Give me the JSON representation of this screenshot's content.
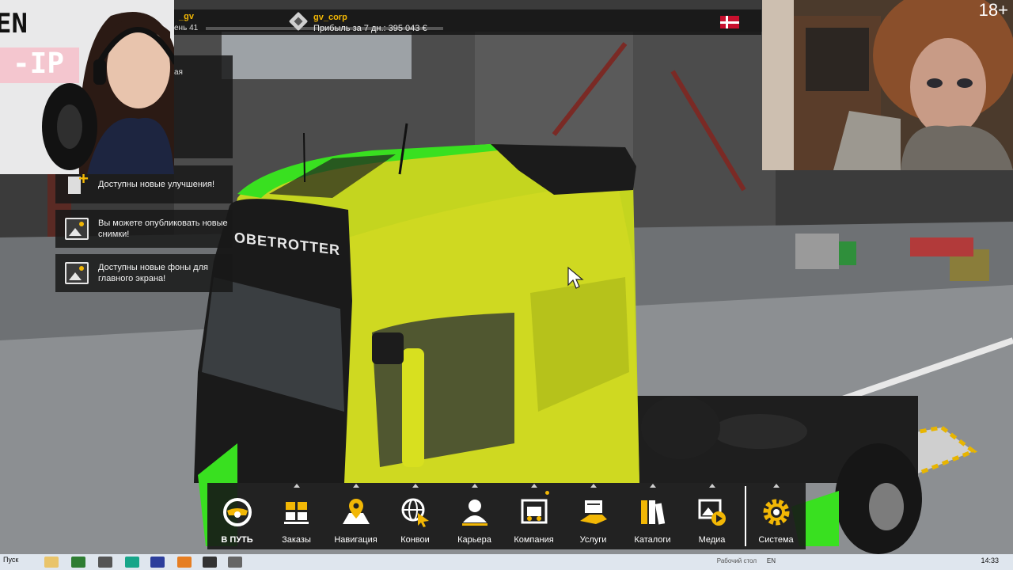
{
  "player": {
    "name": "_gv",
    "level_label": "ень 41"
  },
  "company": {
    "name": "gv_corp",
    "profit_label": "Прибыль за 7 дн.: 395 043 €"
  },
  "notifications": {
    "partial_top": "ая",
    "items": [
      {
        "icon": "upgrade-icon",
        "text": "Доступны новые улучшения!"
      },
      {
        "icon": "photo-icon",
        "text": "Вы можете опубликовать новые снимки!"
      },
      {
        "icon": "photo-icon",
        "text": "Доступны новые фоны для главного экрана!"
      }
    ]
  },
  "truck": {
    "cab_text": "OBETROTTER"
  },
  "webcam_left": {
    "overlay_text_1": "EN",
    "overlay_text_2": "-IP"
  },
  "webcam_right": {
    "rating": "18+"
  },
  "menu": {
    "items": [
      {
        "label": "В ПУТЬ",
        "icon": "steering-wheel-icon"
      },
      {
        "label": "Заказы",
        "icon": "cargo-icon"
      },
      {
        "label": "Навигация",
        "icon": "map-pin-icon"
      },
      {
        "label": "Конвои",
        "icon": "globe-cursor-icon"
      },
      {
        "label": "Карьера",
        "icon": "person-icon"
      },
      {
        "label": "Компания",
        "icon": "garage-icon"
      },
      {
        "label": "Услуги",
        "icon": "services-icon"
      },
      {
        "label": "Каталоги",
        "icon": "catalog-icon"
      },
      {
        "label": "Медиа",
        "icon": "media-icon"
      },
      {
        "label": "Система",
        "icon": "gear-icon"
      }
    ]
  },
  "taskbar": {
    "start_label": "Пуск",
    "desk_label": "Рабочий стол",
    "lang": "EN",
    "time": "14:33"
  },
  "colors": {
    "accent": "#f2b705",
    "truck_paint": "#c4d51f",
    "stripe": "#39e020"
  }
}
